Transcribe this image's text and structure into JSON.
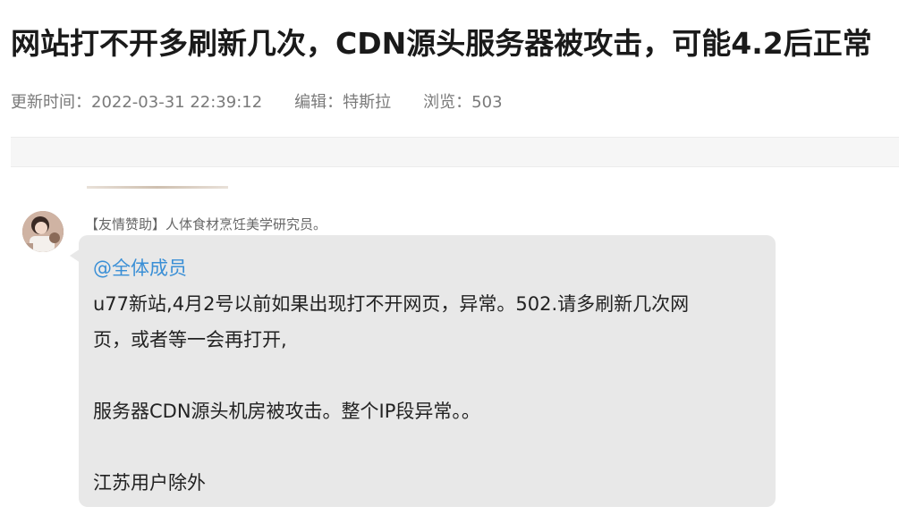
{
  "article": {
    "title": "网站打不开多刷新几次，CDN源头服务器被攻击，可能4.2后正常"
  },
  "meta": {
    "update_time": "更新时间：2022-03-31 22:39:12",
    "editor": "编辑：特斯拉",
    "views": "浏览：503"
  },
  "message": {
    "sender": "【友情赞助】人体食材烹饪美学研究员。",
    "mention": "@全体成员",
    "line1": "u77新站,4月2号以前如果出现打不开网页，异常。502.请多刷新几次网",
    "line2": "页，或者等一会再打开,",
    "line3": "服务器CDN源头机房被攻击。整个IP段异常。。",
    "line4": "江苏用户除外"
  },
  "colors": {
    "mention": "#3a8fd6",
    "bubble": "#e8e8e8",
    "meta_text": "#7a7a7a"
  }
}
